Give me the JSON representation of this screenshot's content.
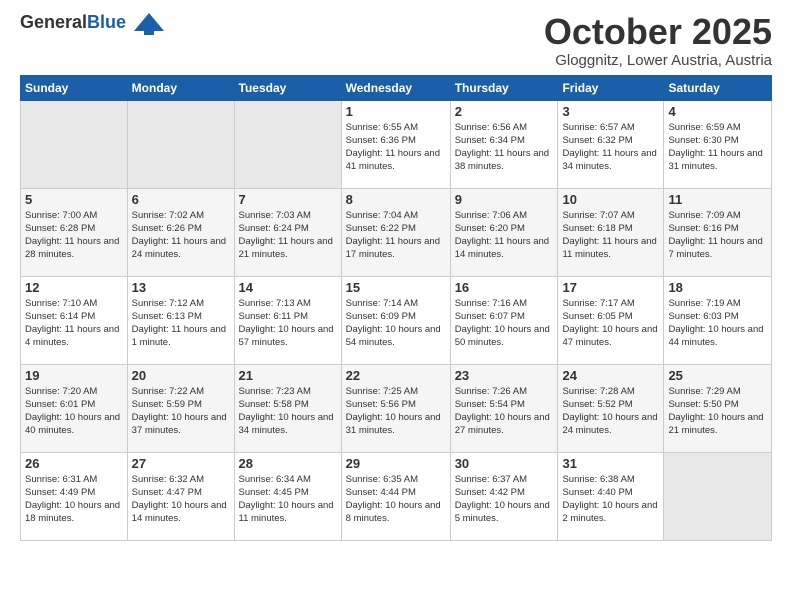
{
  "header": {
    "logo_general": "General",
    "logo_blue": "Blue",
    "month_title": "October 2025",
    "location": "Gloggnitz, Lower Austria, Austria"
  },
  "calendar": {
    "days_of_week": [
      "Sunday",
      "Monday",
      "Tuesday",
      "Wednesday",
      "Thursday",
      "Friday",
      "Saturday"
    ],
    "weeks": [
      [
        {
          "day": "",
          "sunrise": "",
          "sunset": "",
          "daylight": ""
        },
        {
          "day": "",
          "sunrise": "",
          "sunset": "",
          "daylight": ""
        },
        {
          "day": "",
          "sunrise": "",
          "sunset": "",
          "daylight": ""
        },
        {
          "day": "1",
          "sunrise": "Sunrise: 6:55 AM",
          "sunset": "Sunset: 6:36 PM",
          "daylight": "Daylight: 11 hours and 41 minutes."
        },
        {
          "day": "2",
          "sunrise": "Sunrise: 6:56 AM",
          "sunset": "Sunset: 6:34 PM",
          "daylight": "Daylight: 11 hours and 38 minutes."
        },
        {
          "day": "3",
          "sunrise": "Sunrise: 6:57 AM",
          "sunset": "Sunset: 6:32 PM",
          "daylight": "Daylight: 11 hours and 34 minutes."
        },
        {
          "day": "4",
          "sunrise": "Sunrise: 6:59 AM",
          "sunset": "Sunset: 6:30 PM",
          "daylight": "Daylight: 11 hours and 31 minutes."
        }
      ],
      [
        {
          "day": "5",
          "sunrise": "Sunrise: 7:00 AM",
          "sunset": "Sunset: 6:28 PM",
          "daylight": "Daylight: 11 hours and 28 minutes."
        },
        {
          "day": "6",
          "sunrise": "Sunrise: 7:02 AM",
          "sunset": "Sunset: 6:26 PM",
          "daylight": "Daylight: 11 hours and 24 minutes."
        },
        {
          "day": "7",
          "sunrise": "Sunrise: 7:03 AM",
          "sunset": "Sunset: 6:24 PM",
          "daylight": "Daylight: 11 hours and 21 minutes."
        },
        {
          "day": "8",
          "sunrise": "Sunrise: 7:04 AM",
          "sunset": "Sunset: 6:22 PM",
          "daylight": "Daylight: 11 hours and 17 minutes."
        },
        {
          "day": "9",
          "sunrise": "Sunrise: 7:06 AM",
          "sunset": "Sunset: 6:20 PM",
          "daylight": "Daylight: 11 hours and 14 minutes."
        },
        {
          "day": "10",
          "sunrise": "Sunrise: 7:07 AM",
          "sunset": "Sunset: 6:18 PM",
          "daylight": "Daylight: 11 hours and 11 minutes."
        },
        {
          "day": "11",
          "sunrise": "Sunrise: 7:09 AM",
          "sunset": "Sunset: 6:16 PM",
          "daylight": "Daylight: 11 hours and 7 minutes."
        }
      ],
      [
        {
          "day": "12",
          "sunrise": "Sunrise: 7:10 AM",
          "sunset": "Sunset: 6:14 PM",
          "daylight": "Daylight: 11 hours and 4 minutes."
        },
        {
          "day": "13",
          "sunrise": "Sunrise: 7:12 AM",
          "sunset": "Sunset: 6:13 PM",
          "daylight": "Daylight: 11 hours and 1 minute."
        },
        {
          "day": "14",
          "sunrise": "Sunrise: 7:13 AM",
          "sunset": "Sunset: 6:11 PM",
          "daylight": "Daylight: 10 hours and 57 minutes."
        },
        {
          "day": "15",
          "sunrise": "Sunrise: 7:14 AM",
          "sunset": "Sunset: 6:09 PM",
          "daylight": "Daylight: 10 hours and 54 minutes."
        },
        {
          "day": "16",
          "sunrise": "Sunrise: 7:16 AM",
          "sunset": "Sunset: 6:07 PM",
          "daylight": "Daylight: 10 hours and 50 minutes."
        },
        {
          "day": "17",
          "sunrise": "Sunrise: 7:17 AM",
          "sunset": "Sunset: 6:05 PM",
          "daylight": "Daylight: 10 hours and 47 minutes."
        },
        {
          "day": "18",
          "sunrise": "Sunrise: 7:19 AM",
          "sunset": "Sunset: 6:03 PM",
          "daylight": "Daylight: 10 hours and 44 minutes."
        }
      ],
      [
        {
          "day": "19",
          "sunrise": "Sunrise: 7:20 AM",
          "sunset": "Sunset: 6:01 PM",
          "daylight": "Daylight: 10 hours and 40 minutes."
        },
        {
          "day": "20",
          "sunrise": "Sunrise: 7:22 AM",
          "sunset": "Sunset: 5:59 PM",
          "daylight": "Daylight: 10 hours and 37 minutes."
        },
        {
          "day": "21",
          "sunrise": "Sunrise: 7:23 AM",
          "sunset": "Sunset: 5:58 PM",
          "daylight": "Daylight: 10 hours and 34 minutes."
        },
        {
          "day": "22",
          "sunrise": "Sunrise: 7:25 AM",
          "sunset": "Sunset: 5:56 PM",
          "daylight": "Daylight: 10 hours and 31 minutes."
        },
        {
          "day": "23",
          "sunrise": "Sunrise: 7:26 AM",
          "sunset": "Sunset: 5:54 PM",
          "daylight": "Daylight: 10 hours and 27 minutes."
        },
        {
          "day": "24",
          "sunrise": "Sunrise: 7:28 AM",
          "sunset": "Sunset: 5:52 PM",
          "daylight": "Daylight: 10 hours and 24 minutes."
        },
        {
          "day": "25",
          "sunrise": "Sunrise: 7:29 AM",
          "sunset": "Sunset: 5:50 PM",
          "daylight": "Daylight: 10 hours and 21 minutes."
        }
      ],
      [
        {
          "day": "26",
          "sunrise": "Sunrise: 6:31 AM",
          "sunset": "Sunset: 4:49 PM",
          "daylight": "Daylight: 10 hours and 18 minutes."
        },
        {
          "day": "27",
          "sunrise": "Sunrise: 6:32 AM",
          "sunset": "Sunset: 4:47 PM",
          "daylight": "Daylight: 10 hours and 14 minutes."
        },
        {
          "day": "28",
          "sunrise": "Sunrise: 6:34 AM",
          "sunset": "Sunset: 4:45 PM",
          "daylight": "Daylight: 10 hours and 11 minutes."
        },
        {
          "day": "29",
          "sunrise": "Sunrise: 6:35 AM",
          "sunset": "Sunset: 4:44 PM",
          "daylight": "Daylight: 10 hours and 8 minutes."
        },
        {
          "day": "30",
          "sunrise": "Sunrise: 6:37 AM",
          "sunset": "Sunset: 4:42 PM",
          "daylight": "Daylight: 10 hours and 5 minutes."
        },
        {
          "day": "31",
          "sunrise": "Sunrise: 6:38 AM",
          "sunset": "Sunset: 4:40 PM",
          "daylight": "Daylight: 10 hours and 2 minutes."
        },
        {
          "day": "",
          "sunrise": "",
          "sunset": "",
          "daylight": ""
        }
      ]
    ]
  }
}
